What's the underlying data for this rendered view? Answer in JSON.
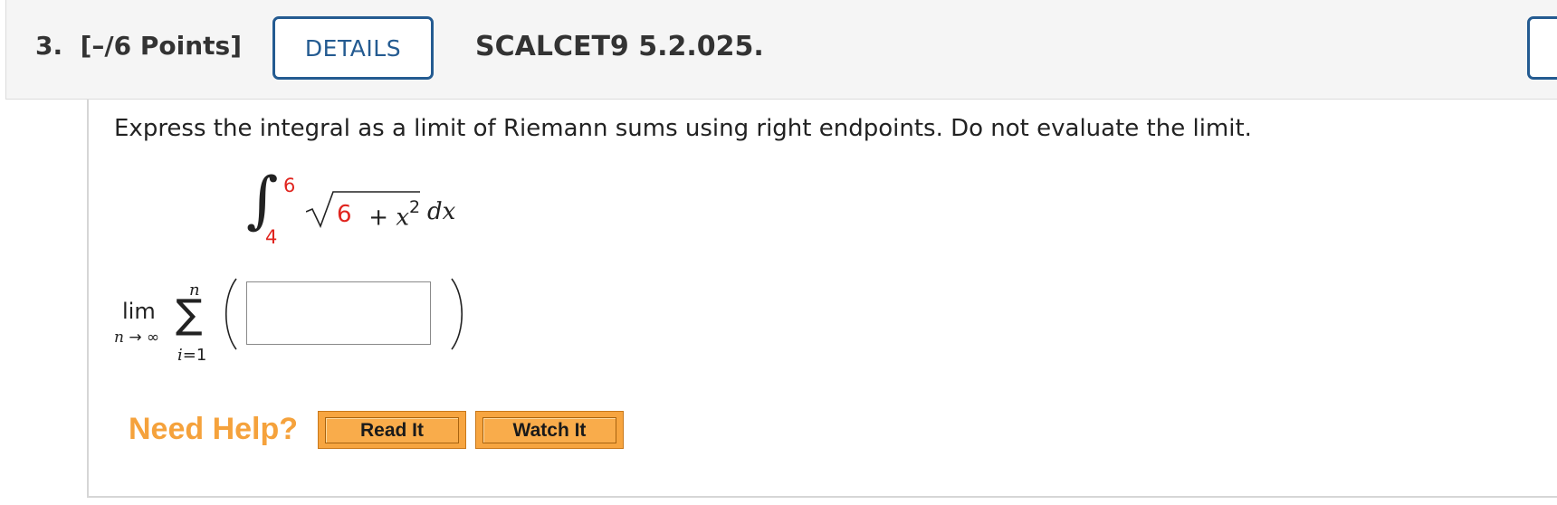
{
  "header": {
    "question_number": "3.",
    "points": "[–/6 Points]",
    "details_label": "DETAILS",
    "assignment_code": "SCALCET9 5.2.025."
  },
  "question": {
    "prompt": "Express the integral as a limit of Riemann sums using right endpoints. Do not evaluate the limit.",
    "integral": {
      "lower_limit": "4",
      "upper_limit": "6",
      "radicand_constant": "6",
      "radicand_operator": "+",
      "radicand_variable": "x",
      "radicand_exponent": "2",
      "differential": "dx"
    },
    "answer_expression": {
      "lim_label": "lim",
      "lim_variable": "n",
      "lim_arrow": "→",
      "lim_target": "∞",
      "sum_upper": "n",
      "sum_index": "i",
      "sum_equals": "=",
      "sum_start": "1",
      "answer_value": "",
      "answer_placeholder": ""
    }
  },
  "help": {
    "need_help_label": "Need Help?",
    "read_it_label": "Read It",
    "watch_it_label": "Watch It"
  },
  "colors": {
    "accent_blue": "#245b91",
    "highlight_red": "#e0251f",
    "help_orange": "#f5a23c",
    "button_orange": "#f9ac4b"
  },
  "icons": {
    "radical": "square-root-sign",
    "integral": "integral-sign",
    "summation": "sigma-sign"
  }
}
